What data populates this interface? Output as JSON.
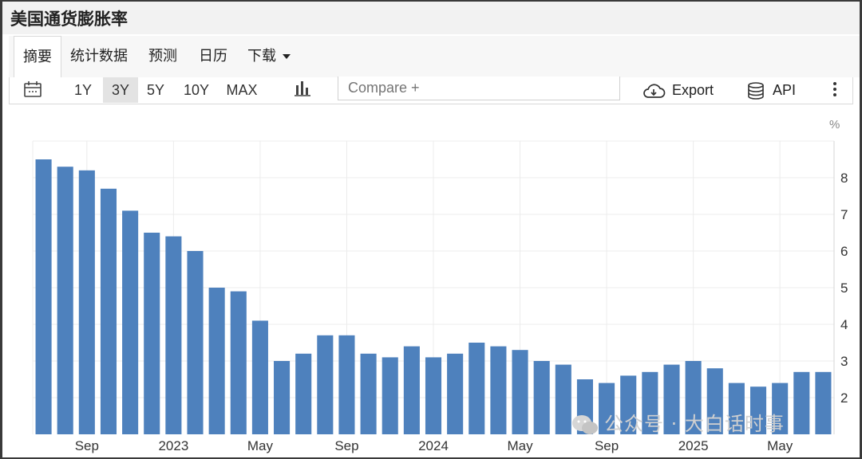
{
  "page": {
    "title": "美国通货膨胀率"
  },
  "tabs": [
    {
      "label": "摘要",
      "active": true
    },
    {
      "label": "统计数据",
      "active": false
    },
    {
      "label": "预测",
      "active": false
    },
    {
      "label": "日历",
      "active": false
    },
    {
      "label": "下载",
      "active": false,
      "dropdown": true
    }
  ],
  "toolbar": {
    "calendar_icon": "calendar-icon",
    "ranges": [
      {
        "label": "1Y",
        "active": false
      },
      {
        "label": "3Y",
        "active": true
      },
      {
        "label": "5Y",
        "active": false
      },
      {
        "label": "10Y",
        "active": false
      },
      {
        "label": "MAX",
        "active": false
      }
    ],
    "chart_type_icon": "bar-chart-icon",
    "compare_placeholder": "Compare +",
    "export_label": "Export",
    "api_label": "API",
    "more_icon": "vertical-ellipsis-icon"
  },
  "watermark": {
    "text": "公众号 · 大白话时事"
  },
  "colors": {
    "bar": "#4e81bd",
    "grid": "#ececec",
    "axis_text": "#333333"
  },
  "chart_data": {
    "type": "bar",
    "unit_label": "%",
    "ylim": [
      1.0,
      9.0
    ],
    "y_ticks": [
      2,
      3,
      4,
      5,
      6,
      7,
      8
    ],
    "y_axis_side": "right",
    "grid": true,
    "x_tick_labels": [
      {
        "label": "Sep",
        "index": 2
      },
      {
        "label": "2023",
        "index": 6
      },
      {
        "label": "May",
        "index": 10
      },
      {
        "label": "Sep",
        "index": 14
      },
      {
        "label": "2024",
        "index": 18
      },
      {
        "label": "May",
        "index": 22
      },
      {
        "label": "Sep",
        "index": 26
      },
      {
        "label": "2025",
        "index": 30
      },
      {
        "label": "May",
        "index": 34
      }
    ],
    "categories": [
      "2022-07",
      "2022-08",
      "2022-09",
      "2022-10",
      "2022-11",
      "2022-12",
      "2023-01",
      "2023-02",
      "2023-03",
      "2023-04",
      "2023-05",
      "2023-06",
      "2023-07",
      "2023-08",
      "2023-09",
      "2023-10",
      "2023-11",
      "2023-12",
      "2024-01",
      "2024-02",
      "2024-03",
      "2024-04",
      "2024-05",
      "2024-06",
      "2024-07",
      "2024-08",
      "2024-09",
      "2024-10",
      "2024-11",
      "2024-12",
      "2025-01",
      "2025-02",
      "2025-03",
      "2025-04",
      "2025-05",
      "2025-06",
      "2025-07"
    ],
    "values": [
      8.5,
      8.3,
      8.2,
      7.7,
      7.1,
      6.5,
      6.4,
      6.0,
      5.0,
      4.9,
      4.1,
      3.0,
      3.2,
      3.7,
      3.7,
      3.2,
      3.1,
      3.4,
      3.1,
      3.2,
      3.5,
      3.4,
      3.3,
      3.0,
      2.9,
      2.5,
      2.4,
      2.6,
      2.7,
      2.9,
      3.0,
      2.8,
      2.4,
      2.3,
      2.4,
      2.7,
      2.7
    ]
  }
}
